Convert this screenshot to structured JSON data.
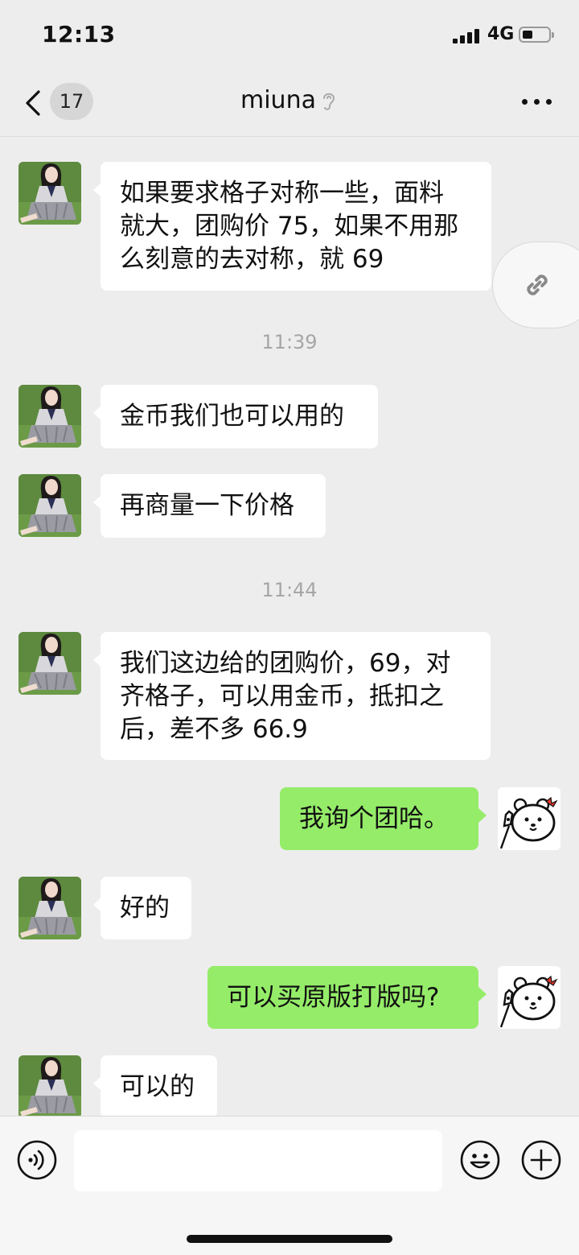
{
  "status": {
    "time": "12:13",
    "network": "4G"
  },
  "header": {
    "back_badge": "17",
    "title": "miuna"
  },
  "messages": [
    {
      "side": "left",
      "text": "如果要求格子对称一些，面料\n就大，团购价 75，如果不用那\n么刻意的去对称，就 69"
    },
    {
      "timestamp": "11:39"
    },
    {
      "side": "left",
      "text": "金币我们也可以用的"
    },
    {
      "side": "left",
      "text": "再商量一下价格"
    },
    {
      "timestamp": "11:44"
    },
    {
      "side": "left",
      "text": "我们这边给的团购价，69，对\n齐格子，可以用金币，抵扣之\n后，差不多 66.9"
    },
    {
      "side": "right",
      "text": "我询个团哈。"
    },
    {
      "side": "left",
      "text": "好的"
    },
    {
      "side": "right",
      "text": "可以买原版打版吗?"
    },
    {
      "side": "left",
      "text": "可以的"
    }
  ],
  "composer": {
    "value": ""
  },
  "colors": {
    "outgoing_bubble": "#95ec69",
    "incoming_bubble": "#ffffff",
    "background": "#ededed"
  },
  "icons": [
    "back-chevron-icon",
    "listening-ear-icon",
    "more-dots-icon",
    "link-icon",
    "voice-icon",
    "emoji-icon",
    "plus-icon"
  ]
}
